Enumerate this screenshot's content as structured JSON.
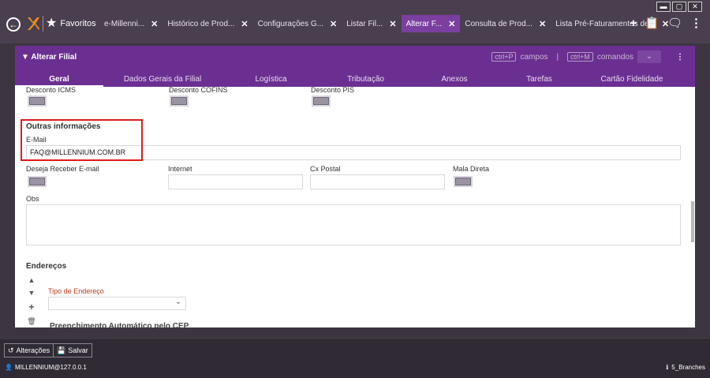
{
  "window": {
    "minimize": "▬",
    "maximize": "▢",
    "close": "✕"
  },
  "nav": {
    "favorites_label": "Favoritos"
  },
  "tabs": [
    {
      "label": "e-Millenni...",
      "close": "✕",
      "active": false
    },
    {
      "label": "Histórico de Prod...",
      "close": "✕",
      "active": false
    },
    {
      "label": "Configurações G...",
      "close": "✕",
      "active": false
    },
    {
      "label": "Listar Fil...",
      "close": "✕",
      "active": false
    },
    {
      "label": "Alterar F...",
      "close": "✕",
      "active": true
    },
    {
      "label": "Consulta de Prod...",
      "close": "✕",
      "active": false
    },
    {
      "label": "Lista Pré-Faturamentos de...",
      "close": "✕",
      "active": false
    }
  ],
  "panel": {
    "title": "Alterar Filial",
    "shortcut_fields_key": "ctrl+P",
    "shortcut_fields_label": "campos",
    "shortcut_divider": "|",
    "shortcut_commands_key": "ctrl+M",
    "shortcut_commands_label": "comandos",
    "tabs": [
      "Geral",
      "Dados Gerais da Filial",
      "Logística",
      "Tributação",
      "Anexos",
      "Tarefas",
      "Cartão Fidelidade"
    ]
  },
  "form": {
    "desconto_icms": "Desconto ICMS",
    "desconto_cofins": "Desconto COFINS",
    "desconto_pis": "Desconto PIS",
    "outras_info": "Outras informações",
    "email_label": "E-Mail",
    "email_value": "FAQ@MILLENNIUM.COM.BR",
    "deseja_receber": "Deseja Receber E-mail",
    "internet": "Internet",
    "cx_postal": "Cx Postal",
    "mala_direta": "Mala Direta",
    "obs": "Obs",
    "enderecos": "Endereços",
    "tipo_endereco": "Tipo de Endereço",
    "preenchimento": "Preenchimento Automático pelo CEP"
  },
  "bottom": {
    "alteracoes": "Alterações",
    "salvar": "Salvar",
    "user": "MILLENNIUM@127.0.0.1",
    "branch": "5_Branches"
  }
}
